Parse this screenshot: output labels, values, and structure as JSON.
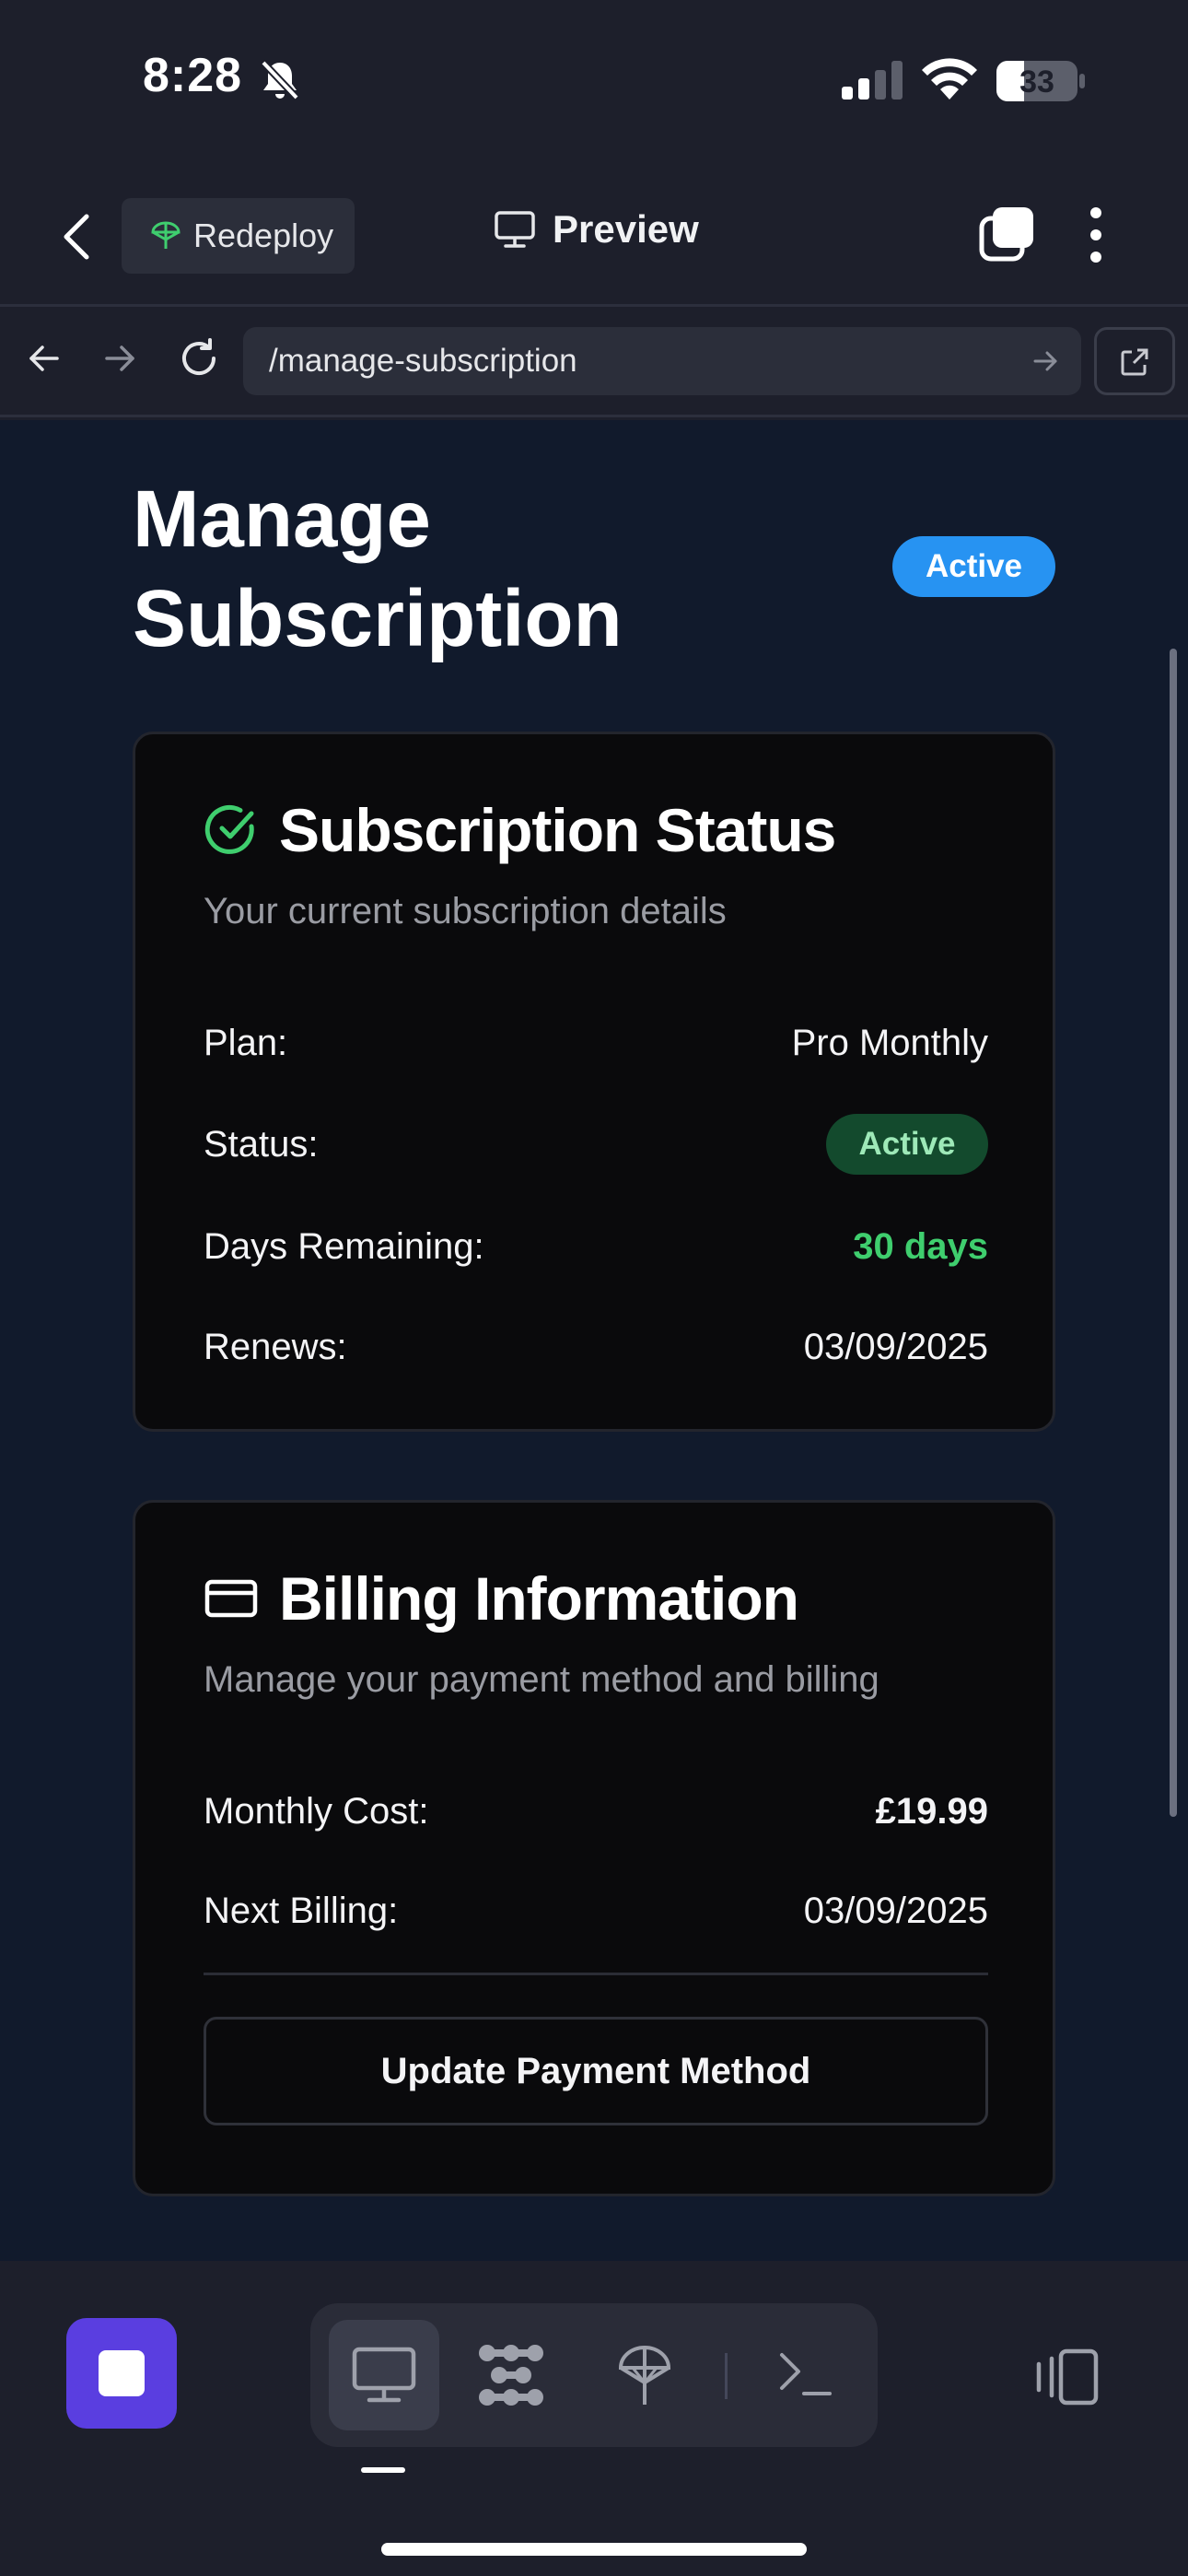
{
  "status_bar": {
    "time": "8:28",
    "battery": "33"
  },
  "app_header": {
    "redeploy_label": "Redeploy",
    "preview_label": "Preview"
  },
  "url_bar": {
    "path": "/manage-subscription"
  },
  "page": {
    "title": "Manage Subscription",
    "status_badge": "Active",
    "subscription_card": {
      "title": "Subscription Status",
      "subtitle": "Your current subscription details",
      "rows": [
        {
          "label": "Plan:",
          "value": "Pro Monthly"
        },
        {
          "label": "Status:",
          "value": "Active"
        },
        {
          "label": "Days Remaining:",
          "value": "30 days"
        },
        {
          "label": "Renews:",
          "value": "03/09/2025"
        }
      ]
    },
    "billing_card": {
      "title": "Billing Information",
      "subtitle": "Manage your payment method and billing",
      "rows": [
        {
          "label": "Monthly Cost:",
          "value": "£19.99"
        },
        {
          "label": "Next Billing:",
          "value": "03/09/2025"
        }
      ],
      "button_label": "Update Payment Method"
    }
  },
  "colors": {
    "accent_blue": "#2793f2",
    "success_green": "#3fce6e",
    "stop_purple": "#5a3ee0"
  },
  "icons": {
    "status_ok": "check-circle-icon",
    "billing": "credit-card-icon",
    "dock": [
      "stop-icon",
      "monitor-icon",
      "grid-dots-icon",
      "deploy-icon",
      "terminal-icon",
      "device-mirror-icon"
    ]
  }
}
